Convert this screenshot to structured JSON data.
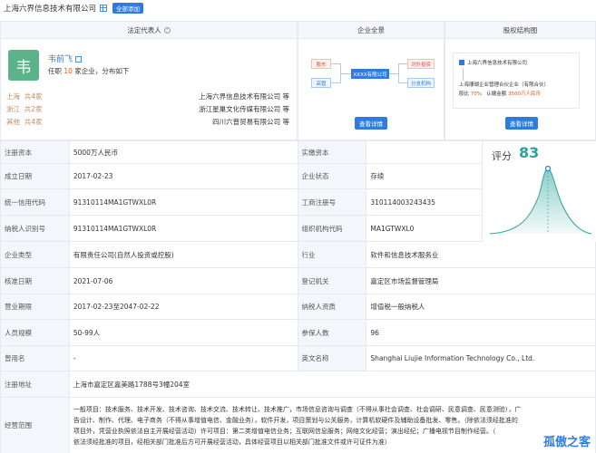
{
  "header": {
    "company": "上海六界信息技术有限公司",
    "add_button": "全部添加"
  },
  "sections": {
    "legal_rep": "法定代表人",
    "enterprise": "企业全景",
    "equity": "股权结构图"
  },
  "person": {
    "avatar_char": "韦",
    "name": "韦前飞",
    "sub_prefix": "任职",
    "sub_count": "10",
    "sub_suffix": "家企业，分布如下",
    "regions": [
      {
        "name": "上海",
        "count": "共4家",
        "company": "上海六界信息技术有限公司 等"
      },
      {
        "name": "浙江",
        "count": "共2家",
        "company": "浙江星巢文化传媒有限公司 等"
      },
      {
        "name": "其他",
        "count": "共4家",
        "company": "四川六普贸易有限公司 等"
      }
    ]
  },
  "enterprise_map": {
    "shareholder": "股东",
    "executive": "高管",
    "center": "XXXX有限公司",
    "investment": "对外投资",
    "branch": "分支机构",
    "detail_button": "查看详情"
  },
  "equity_map": {
    "company": "上海六界信息技术有限公司",
    "holder": "上海珊瑚企业管理合伙企业（有限合伙）",
    "ratio_label": "股比",
    "ratio": "70%",
    "subscribed_label": "认缴金额",
    "subscribed": "3500万人民币",
    "detail_button": "查看详情"
  },
  "info_rows": [
    {
      "l1": "注册资本",
      "v1": "5000万人民币",
      "l2": "实缴资本",
      "v2": ""
    },
    {
      "l1": "成立日期",
      "v1": "2017-02-23",
      "l2": "企业状态",
      "v2": "存续"
    },
    {
      "l1": "统一信用代码",
      "v1": "91310114MA1GTWXL0R",
      "l2": "工商注册号",
      "v2": "310114003243435"
    },
    {
      "l1": "纳税人识别号",
      "v1": "91310114MA1GTWXL0R",
      "l2": "组织机构代码",
      "v2": "MA1GTWXL0"
    },
    {
      "l1": "企业类型",
      "v1": "有限责任公司(自然人投资或控股)",
      "l2": "行业",
      "v2": "软件和信息技术服务业"
    },
    {
      "l1": "核准日期",
      "v1": "2021-07-06",
      "l2": "登记机关",
      "v2": "嘉定区市场监督管理局"
    },
    {
      "l1": "营业期限",
      "v1": "2017-02-23至2047-02-22",
      "l2": "纳税人资质",
      "v2": "增值税一般纳税人"
    },
    {
      "l1": "人员规模",
      "v1": "50-99人",
      "l2": "参保人数",
      "v2": "96"
    },
    {
      "l1": "曾用名",
      "v1": "-",
      "l2": "英文名称",
      "v2": "Shanghai Liujie Information Technology Co., Ltd."
    }
  ],
  "score": {
    "label": "评分",
    "value": "83",
    "color": "#2aa39a"
  },
  "address": {
    "label": "注册地址",
    "value": "上海市嘉定区嘉美路1788号3幢204室"
  },
  "scope": {
    "label": "经营范围",
    "lines": [
      "一般项目：技术服务、技术开发、技术咨询、技术交流、技术转让、技术推广，市场信息咨询与调查（不得从事社会调查、社会调研、民意调查、民意测验），广",
      "告设计、制作、代理、电子商务（不得从事增值电信、金融业务），软件开发，项目策划与公关服务，计算机软硬件及辅助设备批发、零售。（除依法须经批准的",
      "项目外，凭营业执照依法自主开展经营活动）许可项目：第二类增值电信业务；互联网信息服务；网络文化经营；演出经纪；广播电视节目制作经营。（",
      "依法须经批准的项目，经相关部门批准后方可开展经营活动，具体经营项目以相关部门批准文件或许可证件为准）"
    ]
  },
  "watermark": "孤傲之客",
  "colors": {
    "accent": "#2f7ce0",
    "label_bg": "#f3f6fa",
    "highlight": "#e0541e"
  }
}
